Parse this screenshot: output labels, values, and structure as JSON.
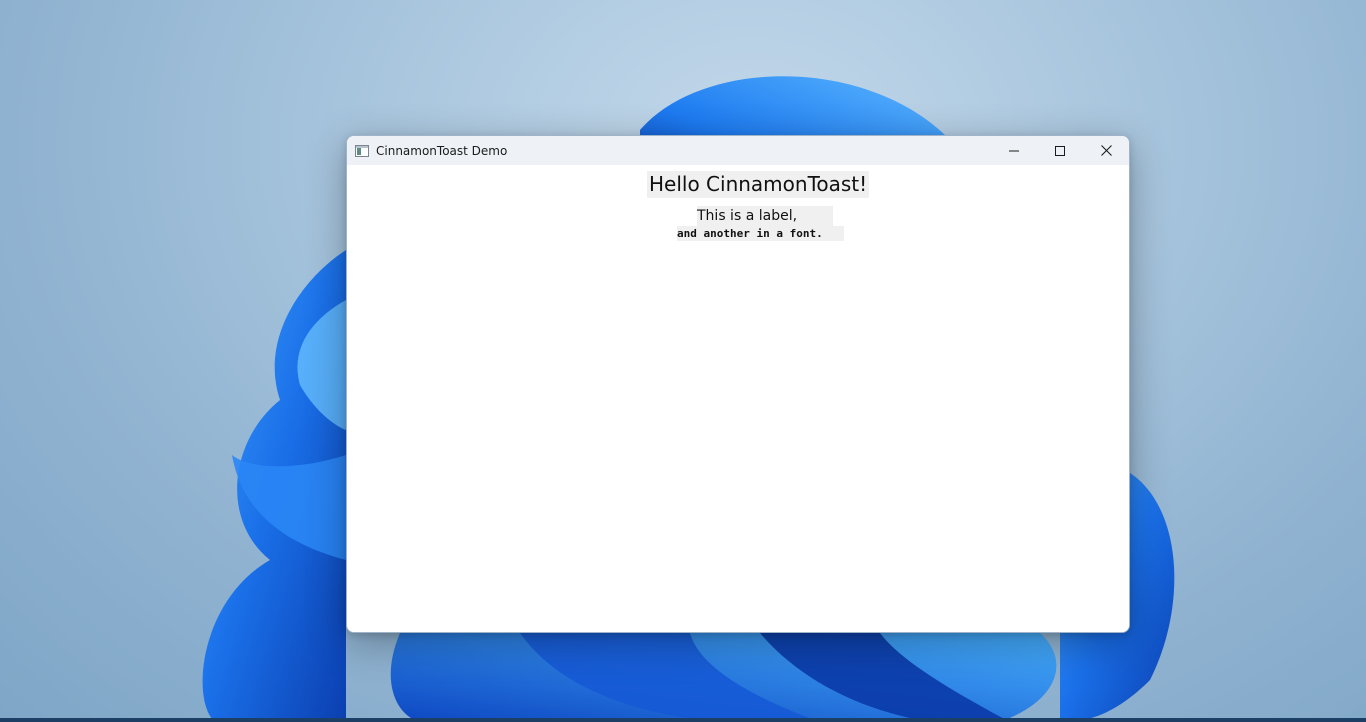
{
  "window": {
    "title": "CinnamonToast Demo",
    "app_icon": "app-window-icon",
    "controls": {
      "minimize_icon": "minimize-icon",
      "maximize_icon": "maximize-icon",
      "close_icon": "close-icon"
    }
  },
  "content": {
    "heading": "Hello CinnamonToast!",
    "label": "This is a label,",
    "font_label": "and another in a font."
  },
  "colors": {
    "titlebar": "#eef2f6",
    "label_background": "#f0f0f0",
    "wallpaper_accent": "#1a6fe8"
  }
}
